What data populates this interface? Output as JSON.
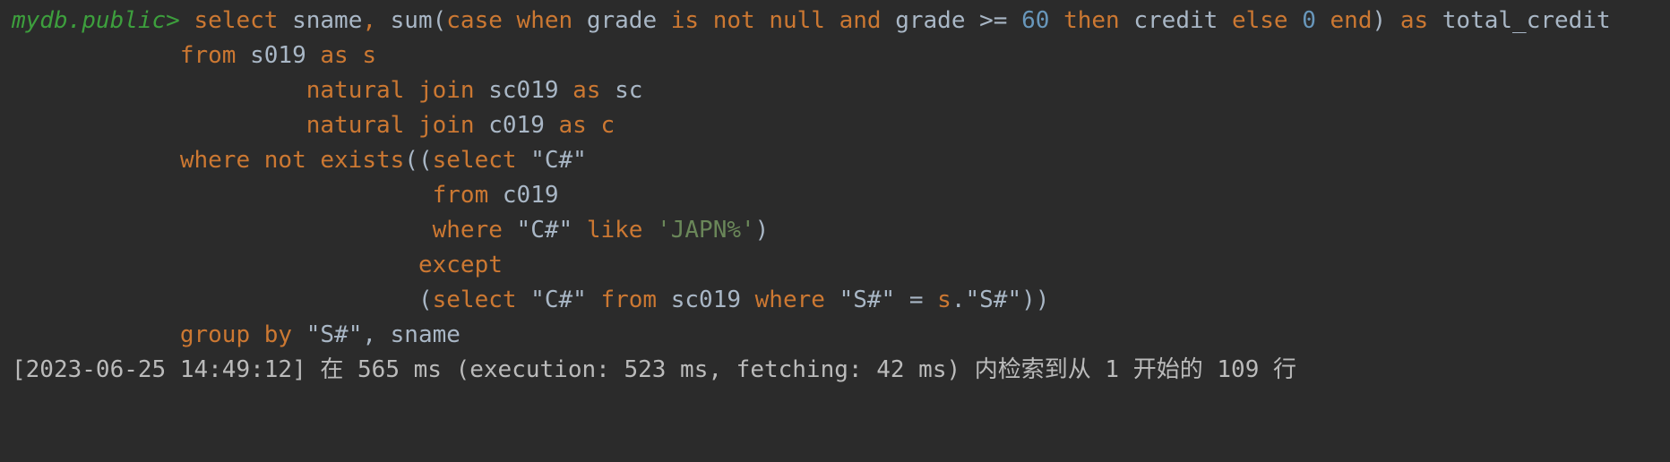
{
  "console": {
    "prompt": "mydb.public>",
    "lines": [
      [
        {
          "t": "select",
          "c": "kw"
        },
        {
          "t": " sname",
          "c": "id"
        },
        {
          "t": ",",
          "c": "kw"
        },
        {
          "t": " sum(",
          "c": "id"
        },
        {
          "t": "case when",
          "c": "kw"
        },
        {
          "t": " grade ",
          "c": "id"
        },
        {
          "t": "is not null and",
          "c": "kw"
        },
        {
          "t": " grade >= ",
          "c": "id"
        },
        {
          "t": "60",
          "c": "num"
        },
        {
          "t": " then",
          "c": "kw"
        },
        {
          "t": " credit ",
          "c": "id"
        },
        {
          "t": "else",
          "c": "kw"
        },
        {
          "t": " 0",
          "c": "num"
        },
        {
          "t": " end",
          "c": "kw"
        },
        {
          "t": ") ",
          "c": "id"
        },
        {
          "t": "as",
          "c": "kw"
        },
        {
          "t": " total_credit",
          "c": "id"
        }
      ],
      [
        {
          "t": "            ",
          "c": "id"
        },
        {
          "t": "from",
          "c": "kw"
        },
        {
          "t": " s019 ",
          "c": "id"
        },
        {
          "t": "as s",
          "c": "kw"
        }
      ],
      [
        {
          "t": "                     ",
          "c": "id"
        },
        {
          "t": "natural join",
          "c": "kw"
        },
        {
          "t": " sc019 ",
          "c": "id"
        },
        {
          "t": "as",
          "c": "kw"
        },
        {
          "t": " sc",
          "c": "id"
        }
      ],
      [
        {
          "t": "                     ",
          "c": "id"
        },
        {
          "t": "natural join",
          "c": "kw"
        },
        {
          "t": " c019 ",
          "c": "id"
        },
        {
          "t": "as c",
          "c": "kw"
        }
      ],
      [
        {
          "t": "            ",
          "c": "id"
        },
        {
          "t": "where not exists",
          "c": "kw"
        },
        {
          "t": "((",
          "c": "id"
        },
        {
          "t": "select",
          "c": "kw"
        },
        {
          "t": " \"C#\"",
          "c": "id"
        }
      ],
      [
        {
          "t": "                              ",
          "c": "id"
        },
        {
          "t": "from",
          "c": "kw"
        },
        {
          "t": " c019",
          "c": "id"
        }
      ],
      [
        {
          "t": "                              ",
          "c": "id"
        },
        {
          "t": "where",
          "c": "kw"
        },
        {
          "t": " \"C#\" ",
          "c": "id"
        },
        {
          "t": "like",
          "c": "kw"
        },
        {
          "t": " 'JAPN%'",
          "c": "str"
        },
        {
          "t": ")",
          "c": "id"
        }
      ],
      [
        {
          "t": "                             ",
          "c": "id"
        },
        {
          "t": "except",
          "c": "kw"
        }
      ],
      [
        {
          "t": "                             ",
          "c": "id"
        },
        {
          "t": "(",
          "c": "id"
        },
        {
          "t": "select",
          "c": "kw"
        },
        {
          "t": " \"C#\" ",
          "c": "id"
        },
        {
          "t": "from",
          "c": "kw"
        },
        {
          "t": " sc019 ",
          "c": "id"
        },
        {
          "t": "where",
          "c": "kw"
        },
        {
          "t": " \"S#\" = ",
          "c": "id"
        },
        {
          "t": "s",
          "c": "kw"
        },
        {
          "t": ".\"S#\"))",
          "c": "id"
        }
      ],
      [
        {
          "t": "            ",
          "c": "id"
        },
        {
          "t": "group by",
          "c": "kw"
        },
        {
          "t": " \"S#\", sname",
          "c": "id"
        }
      ]
    ],
    "status": "[2023-06-25 14:49:12] 在 565 ms (execution: 523 ms, fetching: 42 ms) 内检索到从 1 开始的 109 行",
    "colors": {
      "background": "#2b2b2b",
      "keyword": "#cc7832",
      "identifier": "#a9b7c6",
      "number": "#6897bb",
      "string": "#6a8759",
      "prompt": "#3d9f3d"
    }
  }
}
